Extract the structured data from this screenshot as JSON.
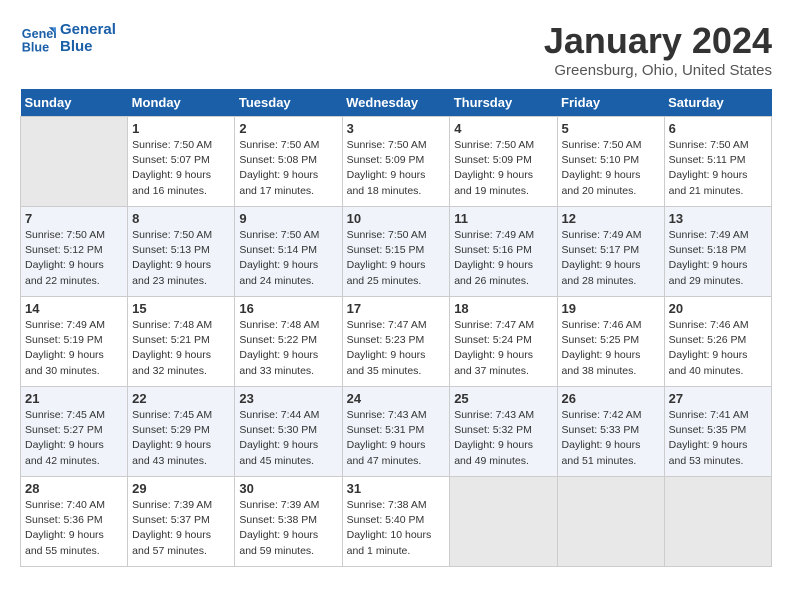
{
  "logo": {
    "line1": "General",
    "line2": "Blue"
  },
  "title": "January 2024",
  "subtitle": "Greensburg, Ohio, United States",
  "days_of_week": [
    "Sunday",
    "Monday",
    "Tuesday",
    "Wednesday",
    "Thursday",
    "Friday",
    "Saturday"
  ],
  "weeks": [
    [
      {
        "day": "",
        "empty": true
      },
      {
        "day": "1",
        "sunrise": "Sunrise: 7:50 AM",
        "sunset": "Sunset: 5:07 PM",
        "daylight": "Daylight: 9 hours and 16 minutes."
      },
      {
        "day": "2",
        "sunrise": "Sunrise: 7:50 AM",
        "sunset": "Sunset: 5:08 PM",
        "daylight": "Daylight: 9 hours and 17 minutes."
      },
      {
        "day": "3",
        "sunrise": "Sunrise: 7:50 AM",
        "sunset": "Sunset: 5:09 PM",
        "daylight": "Daylight: 9 hours and 18 minutes."
      },
      {
        "day": "4",
        "sunrise": "Sunrise: 7:50 AM",
        "sunset": "Sunset: 5:09 PM",
        "daylight": "Daylight: 9 hours and 19 minutes."
      },
      {
        "day": "5",
        "sunrise": "Sunrise: 7:50 AM",
        "sunset": "Sunset: 5:10 PM",
        "daylight": "Daylight: 9 hours and 20 minutes."
      },
      {
        "day": "6",
        "sunrise": "Sunrise: 7:50 AM",
        "sunset": "Sunset: 5:11 PM",
        "daylight": "Daylight: 9 hours and 21 minutes."
      }
    ],
    [
      {
        "day": "7",
        "sunrise": "Sunrise: 7:50 AM",
        "sunset": "Sunset: 5:12 PM",
        "daylight": "Daylight: 9 hours and 22 minutes."
      },
      {
        "day": "8",
        "sunrise": "Sunrise: 7:50 AM",
        "sunset": "Sunset: 5:13 PM",
        "daylight": "Daylight: 9 hours and 23 minutes."
      },
      {
        "day": "9",
        "sunrise": "Sunrise: 7:50 AM",
        "sunset": "Sunset: 5:14 PM",
        "daylight": "Daylight: 9 hours and 24 minutes."
      },
      {
        "day": "10",
        "sunrise": "Sunrise: 7:50 AM",
        "sunset": "Sunset: 5:15 PM",
        "daylight": "Daylight: 9 hours and 25 minutes."
      },
      {
        "day": "11",
        "sunrise": "Sunrise: 7:49 AM",
        "sunset": "Sunset: 5:16 PM",
        "daylight": "Daylight: 9 hours and 26 minutes."
      },
      {
        "day": "12",
        "sunrise": "Sunrise: 7:49 AM",
        "sunset": "Sunset: 5:17 PM",
        "daylight": "Daylight: 9 hours and 28 minutes."
      },
      {
        "day": "13",
        "sunrise": "Sunrise: 7:49 AM",
        "sunset": "Sunset: 5:18 PM",
        "daylight": "Daylight: 9 hours and 29 minutes."
      }
    ],
    [
      {
        "day": "14",
        "sunrise": "Sunrise: 7:49 AM",
        "sunset": "Sunset: 5:19 PM",
        "daylight": "Daylight: 9 hours and 30 minutes."
      },
      {
        "day": "15",
        "sunrise": "Sunrise: 7:48 AM",
        "sunset": "Sunset: 5:21 PM",
        "daylight": "Daylight: 9 hours and 32 minutes."
      },
      {
        "day": "16",
        "sunrise": "Sunrise: 7:48 AM",
        "sunset": "Sunset: 5:22 PM",
        "daylight": "Daylight: 9 hours and 33 minutes."
      },
      {
        "day": "17",
        "sunrise": "Sunrise: 7:47 AM",
        "sunset": "Sunset: 5:23 PM",
        "daylight": "Daylight: 9 hours and 35 minutes."
      },
      {
        "day": "18",
        "sunrise": "Sunrise: 7:47 AM",
        "sunset": "Sunset: 5:24 PM",
        "daylight": "Daylight: 9 hours and 37 minutes."
      },
      {
        "day": "19",
        "sunrise": "Sunrise: 7:46 AM",
        "sunset": "Sunset: 5:25 PM",
        "daylight": "Daylight: 9 hours and 38 minutes."
      },
      {
        "day": "20",
        "sunrise": "Sunrise: 7:46 AM",
        "sunset": "Sunset: 5:26 PM",
        "daylight": "Daylight: 9 hours and 40 minutes."
      }
    ],
    [
      {
        "day": "21",
        "sunrise": "Sunrise: 7:45 AM",
        "sunset": "Sunset: 5:27 PM",
        "daylight": "Daylight: 9 hours and 42 minutes."
      },
      {
        "day": "22",
        "sunrise": "Sunrise: 7:45 AM",
        "sunset": "Sunset: 5:29 PM",
        "daylight": "Daylight: 9 hours and 43 minutes."
      },
      {
        "day": "23",
        "sunrise": "Sunrise: 7:44 AM",
        "sunset": "Sunset: 5:30 PM",
        "daylight": "Daylight: 9 hours and 45 minutes."
      },
      {
        "day": "24",
        "sunrise": "Sunrise: 7:43 AM",
        "sunset": "Sunset: 5:31 PM",
        "daylight": "Daylight: 9 hours and 47 minutes."
      },
      {
        "day": "25",
        "sunrise": "Sunrise: 7:43 AM",
        "sunset": "Sunset: 5:32 PM",
        "daylight": "Daylight: 9 hours and 49 minutes."
      },
      {
        "day": "26",
        "sunrise": "Sunrise: 7:42 AM",
        "sunset": "Sunset: 5:33 PM",
        "daylight": "Daylight: 9 hours and 51 minutes."
      },
      {
        "day": "27",
        "sunrise": "Sunrise: 7:41 AM",
        "sunset": "Sunset: 5:35 PM",
        "daylight": "Daylight: 9 hours and 53 minutes."
      }
    ],
    [
      {
        "day": "28",
        "sunrise": "Sunrise: 7:40 AM",
        "sunset": "Sunset: 5:36 PM",
        "daylight": "Daylight: 9 hours and 55 minutes."
      },
      {
        "day": "29",
        "sunrise": "Sunrise: 7:39 AM",
        "sunset": "Sunset: 5:37 PM",
        "daylight": "Daylight: 9 hours and 57 minutes."
      },
      {
        "day": "30",
        "sunrise": "Sunrise: 7:39 AM",
        "sunset": "Sunset: 5:38 PM",
        "daylight": "Daylight: 9 hours and 59 minutes."
      },
      {
        "day": "31",
        "sunrise": "Sunrise: 7:38 AM",
        "sunset": "Sunset: 5:40 PM",
        "daylight": "Daylight: 10 hours and 1 minute."
      },
      {
        "day": "",
        "empty": true
      },
      {
        "day": "",
        "empty": true
      },
      {
        "day": "",
        "empty": true
      }
    ]
  ]
}
